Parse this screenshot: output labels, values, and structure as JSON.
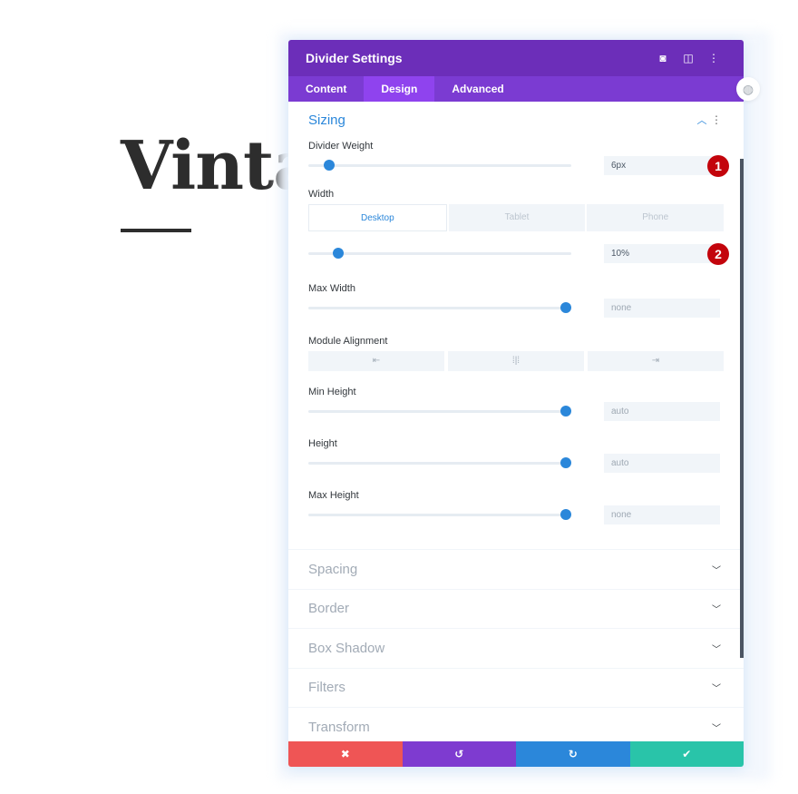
{
  "background": {
    "heading": "Vintag",
    "divider_color": "#2d2d2d"
  },
  "panel": {
    "title": "Divider Settings",
    "header_icons": [
      "focus-icon",
      "split-view-icon",
      "more-vertical-icon"
    ],
    "tabs": [
      {
        "label": "Content",
        "active": false
      },
      {
        "label": "Design",
        "active": true
      },
      {
        "label": "Advanced",
        "active": false
      }
    ],
    "colors": {
      "header": "#6c2eb9",
      "tabs": "#7b3bd2",
      "tab_active": "#8f43ee",
      "accent": "#2b87da",
      "badge": "#c3040c"
    },
    "section": {
      "name": "Sizing",
      "expanded": true
    },
    "fields": {
      "divider_weight": {
        "label": "Divider Weight",
        "value": "6px",
        "slider_fraction": 0.08,
        "badge": "1"
      },
      "width": {
        "label": "Width",
        "device_tabs": [
          "Desktop",
          "Tablet",
          "Phone"
        ],
        "active_device": "Desktop",
        "value": "10%",
        "slider_fraction": 0.115,
        "badge": "2"
      },
      "max_width": {
        "label": "Max Width",
        "value": "none",
        "slider_fraction": 0.98
      },
      "module_alignment": {
        "label": "Module Alignment",
        "options": [
          {
            "name": "align-left",
            "glyph": "⇤"
          },
          {
            "name": "align-center",
            "glyph": "⁞|⁞"
          },
          {
            "name": "align-right",
            "glyph": "⇥"
          }
        ]
      },
      "min_height": {
        "label": "Min Height",
        "value": "auto",
        "slider_fraction": 0.98
      },
      "height": {
        "label": "Height",
        "value": "auto",
        "slider_fraction": 0.98
      },
      "max_height": {
        "label": "Max Height",
        "value": "none",
        "slider_fraction": 0.98
      }
    },
    "collapsed_sections": [
      "Spacing",
      "Border",
      "Box Shadow",
      "Filters",
      "Transform"
    ],
    "footer": [
      {
        "name": "cancel",
        "glyph": "✖",
        "color": "#ef5555"
      },
      {
        "name": "undo",
        "glyph": "↺",
        "color": "#7e3bd0"
      },
      {
        "name": "redo",
        "glyph": "↻",
        "color": "#2b87da"
      },
      {
        "name": "save",
        "glyph": "✔",
        "color": "#29c4a9"
      }
    ]
  }
}
